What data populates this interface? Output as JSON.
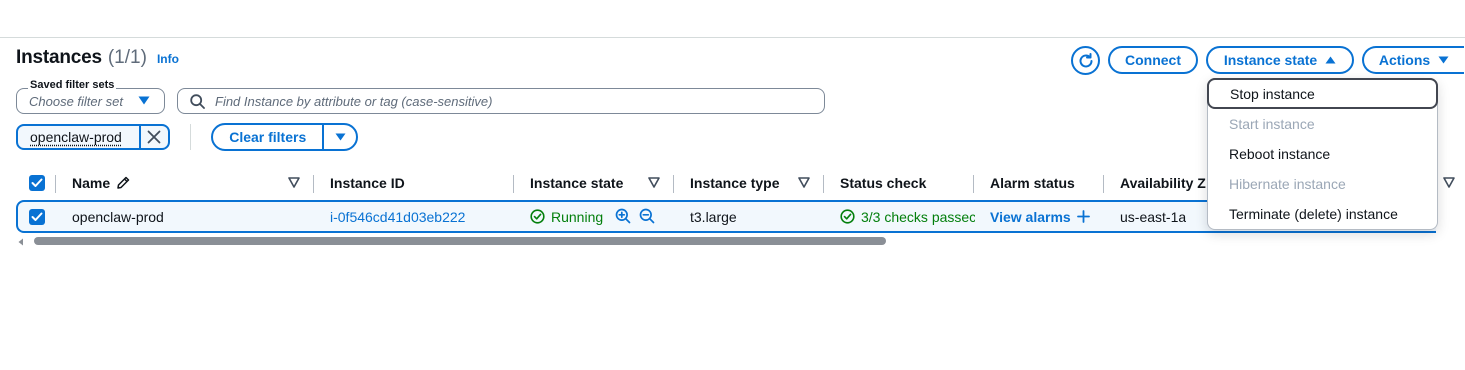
{
  "header": {
    "title": "Instances",
    "count": "(1/1)",
    "info_label": "Info"
  },
  "toolbar": {
    "connect_label": "Connect",
    "instance_state_label": "Instance state",
    "actions_label": "Actions"
  },
  "filters": {
    "saved_filter_sets_label": "Saved filter sets",
    "saved_filter_sets_placeholder": "Choose filter set",
    "search_placeholder": "Find Instance by attribute or tag (case-sensitive)",
    "token_value": "openclaw-prod",
    "clear_filters_label": "Clear filters"
  },
  "table": {
    "columns": [
      "Name",
      "Instance ID",
      "Instance state",
      "Instance type",
      "Status check",
      "Alarm status",
      "Availability Z"
    ],
    "rows": [
      {
        "name": "openclaw-prod",
        "instance_id": "i-0f546cd41d03eb222",
        "state": "Running",
        "type": "t3.large",
        "status_check": "3/3 checks passec",
        "alarm_status": "View alarms",
        "availability_zone": "us-east-1a"
      }
    ]
  },
  "instance_state_menu": {
    "items": [
      {
        "label": "Stop instance",
        "disabled": false
      },
      {
        "label": "Start instance",
        "disabled": true
      },
      {
        "label": "Reboot instance",
        "disabled": false
      },
      {
        "label": "Hibernate instance",
        "disabled": true
      },
      {
        "label": "Terminate (delete) instance",
        "disabled": false
      }
    ]
  },
  "colors": {
    "accent": "#0972d3",
    "success": "#037f0c",
    "disabled": "#9ba7b6",
    "selected_row_bg": "#f2f8fd"
  },
  "icons": {
    "refresh": "refresh-icon",
    "search": "search-icon",
    "edit": "pencil-icon",
    "running": "check-circle-icon",
    "zoom_in": "zoom-in-icon",
    "zoom_out": "zoom-out-icon",
    "add": "plus-icon"
  }
}
